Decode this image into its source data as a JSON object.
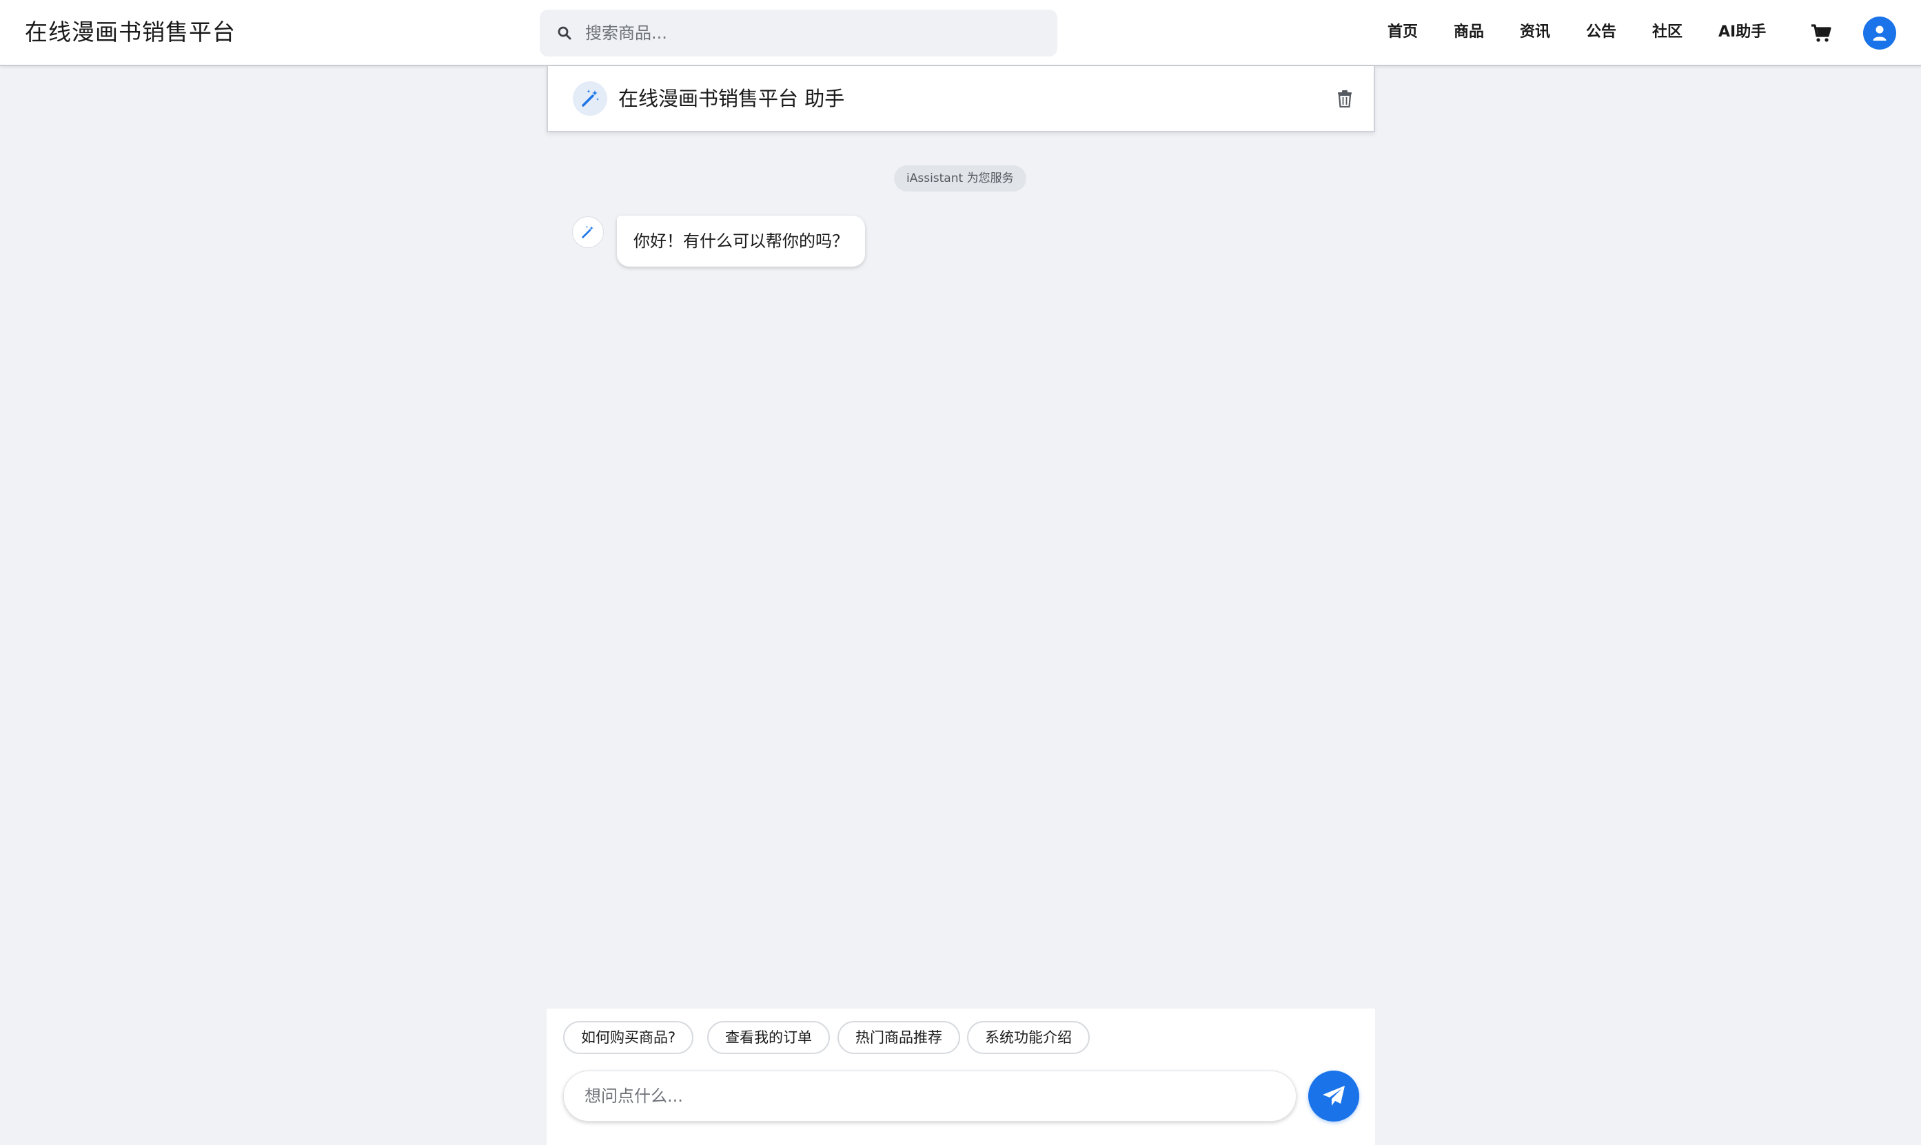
{
  "navbar": {
    "brand": "在线漫画书销售平台",
    "search_placeholder": "搜索商品...",
    "links": [
      "首页",
      "商品",
      "资讯",
      "公告",
      "社区",
      "AI助手"
    ],
    "icons": {
      "search": "search-icon",
      "cart": "cart-icon",
      "user": "user-icon"
    }
  },
  "chat": {
    "title": "在线漫画书销售平台 助手",
    "service_notice": "iAssistant 为您服务",
    "messages": [
      {
        "role": "assistant",
        "text": "你好！有什么可以帮你的吗？"
      }
    ],
    "icons": {
      "bot": "magic-wand-icon",
      "clear": "trash-icon"
    }
  },
  "composer": {
    "quick_replies": [
      "如何购买商品?",
      "查看我的订单",
      "热门商品推荐",
      "系统功能介绍"
    ],
    "input_placeholder": "想问点什么...",
    "send_icon": "paper-plane-icon"
  },
  "colors": {
    "accent": "#1a73e8",
    "page_background": "#f0f2f6",
    "panel_background": "#ffffff"
  }
}
